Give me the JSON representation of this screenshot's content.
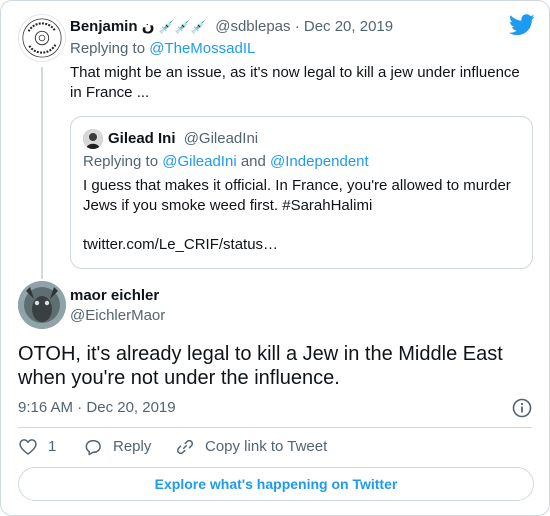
{
  "parent_tweet": {
    "author_name": "Benjamin ن",
    "author_emoji": "💉💉💉",
    "handle": "@sdblepas",
    "separator": "·",
    "date": "Dec 20, 2019",
    "replying_prefix": "Replying to",
    "replying_to": "@TheMossadIL",
    "text": "That might be an issue, as it's now legal to kill a jew under influence in France ...",
    "avatar_badge": "CERTIFIED DYSLEXIC"
  },
  "quoted_tweet": {
    "author_name": "Gilead Ini",
    "handle": "@GileadIni",
    "replying_prefix": "Replying to",
    "replying_to_1": "@GileadIni",
    "replying_and": "and",
    "replying_to_2": "@Independent",
    "text": "I guess that makes it official. In France, you're allowed to murder Jews if you smoke weed first.  #SarahHalimi",
    "link": "twitter.com/Le_CRIF/status…"
  },
  "main_tweet": {
    "author_name": "maor eichler",
    "handle": "@EichlerMaor",
    "text": "OTOH, it's already legal to kill a Jew in the Middle East when you're not under the influence.",
    "time": "9:16 AM",
    "separator": "·",
    "date": "Dec 20, 2019"
  },
  "actions": {
    "like_count": "1",
    "reply_label": "Reply",
    "copy_link_label": "Copy link to Tweet"
  },
  "explore_button": "Explore what's happening on Twitter",
  "icons": {
    "brand": "twitter-bird-icon",
    "info": "info-icon",
    "like": "heart-icon",
    "reply": "reply-bubble-icon",
    "copy": "link-icon"
  },
  "colors": {
    "accent": "#1d9bf0",
    "text": "#0f1419",
    "secondary": "#536471",
    "border": "#cfd9de"
  }
}
